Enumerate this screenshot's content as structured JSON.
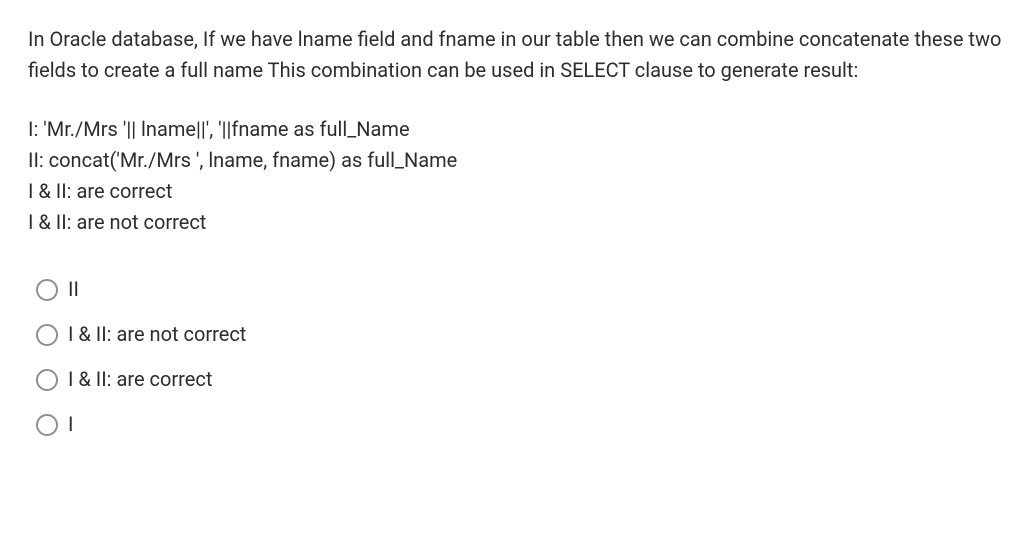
{
  "question": {
    "stem": "In Oracle database, If we have lname field and fname in our table then we can combine concatenate these two fields to create a full name  This combination can be used in SELECT clause to generate result:",
    "statements": [
      "I:   'Mr./Mrs '|| lname||', '||fname as full_Name",
      "II:   concat('Mr./Mrs ', lname, fname) as full_Name",
      "I & II: are correct",
      "I & II: are not correct"
    ]
  },
  "options": [
    {
      "label": "II"
    },
    {
      "label": "I & II: are not correct"
    },
    {
      "label": "I & II: are correct"
    },
    {
      "label": "I"
    }
  ]
}
